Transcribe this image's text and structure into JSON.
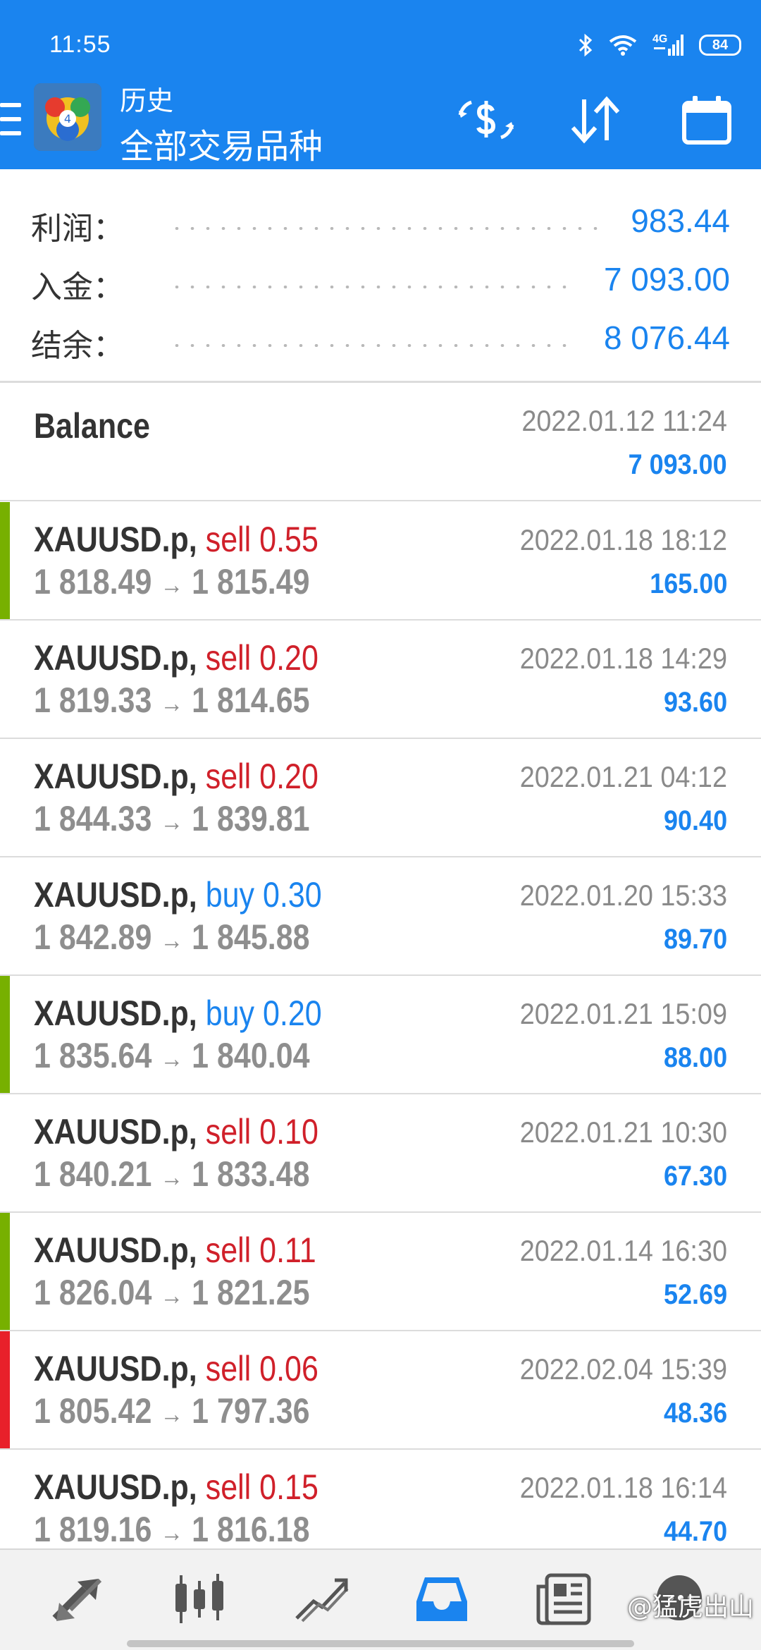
{
  "status_bar": {
    "time": "11:55",
    "network": "4G",
    "battery": "84"
  },
  "header": {
    "subtitle": "历史",
    "title": "全部交易品种"
  },
  "summary": [
    {
      "label": "利润：",
      "value": "983.44"
    },
    {
      "label": "入金：",
      "value": "7 093.00"
    },
    {
      "label": "结余：",
      "value": "8 076.44"
    }
  ],
  "balance": {
    "title": "Balance",
    "time": "2022.01.12 11:24",
    "amount": "7 093.00"
  },
  "trades": [
    {
      "symbol": "XAUUSD.p,",
      "type": "sell 0.55",
      "side": "sell",
      "open": "1 818.49",
      "close": "1 815.49",
      "time": "2022.01.18 18:12",
      "profit": "165.00",
      "bar": "#77b000"
    },
    {
      "symbol": "XAUUSD.p,",
      "type": "sell 0.20",
      "side": "sell",
      "open": "1 819.33",
      "close": "1 814.65",
      "time": "2022.01.18 14:29",
      "profit": "93.60",
      "bar": ""
    },
    {
      "symbol": "XAUUSD.p,",
      "type": "sell 0.20",
      "side": "sell",
      "open": "1 844.33",
      "close": "1 839.81",
      "time": "2022.01.21 04:12",
      "profit": "90.40",
      "bar": ""
    },
    {
      "symbol": "XAUUSD.p,",
      "type": "buy 0.30",
      "side": "buy",
      "open": "1 842.89",
      "close": "1 845.88",
      "time": "2022.01.20 15:33",
      "profit": "89.70",
      "bar": ""
    },
    {
      "symbol": "XAUUSD.p,",
      "type": "buy 0.20",
      "side": "buy",
      "open": "1 835.64",
      "close": "1 840.04",
      "time": "2022.01.21 15:09",
      "profit": "88.00",
      "bar": "#77b000"
    },
    {
      "symbol": "XAUUSD.p,",
      "type": "sell 0.10",
      "side": "sell",
      "open": "1 840.21",
      "close": "1 833.48",
      "time": "2022.01.21 10:30",
      "profit": "67.30",
      "bar": ""
    },
    {
      "symbol": "XAUUSD.p,",
      "type": "sell 0.11",
      "side": "sell",
      "open": "1 826.04",
      "close": "1 821.25",
      "time": "2022.01.14 16:30",
      "profit": "52.69",
      "bar": "#77b000"
    },
    {
      "symbol": "XAUUSD.p,",
      "type": "sell 0.06",
      "side": "sell",
      "open": "1 805.42",
      "close": "1 797.36",
      "time": "2022.02.04 15:39",
      "profit": "48.36",
      "bar": "#e8202a"
    },
    {
      "symbol": "XAUUSD.p,",
      "type": "sell 0.15",
      "side": "sell",
      "open": "1 819.16",
      "close": "1 816.18",
      "time": "2022.01.18 16:14",
      "profit": "44.70",
      "bar": ""
    }
  ],
  "arrow": "→",
  "colors": {
    "accent": "#1a84ef",
    "sell": "#d0202a",
    "buy": "#1a84ef",
    "bar_green": "#77b000",
    "bar_red": "#e8202a"
  },
  "bottom_nav": [
    {
      "icon": "quotes-arrows-icon"
    },
    {
      "icon": "candlestick-chart-icon"
    },
    {
      "icon": "trade-lines-icon"
    },
    {
      "icon": "history-tray-icon",
      "active": true
    },
    {
      "icon": "news-icon"
    },
    {
      "icon": "chat-icon"
    }
  ],
  "watermark": "@猛虎出山"
}
